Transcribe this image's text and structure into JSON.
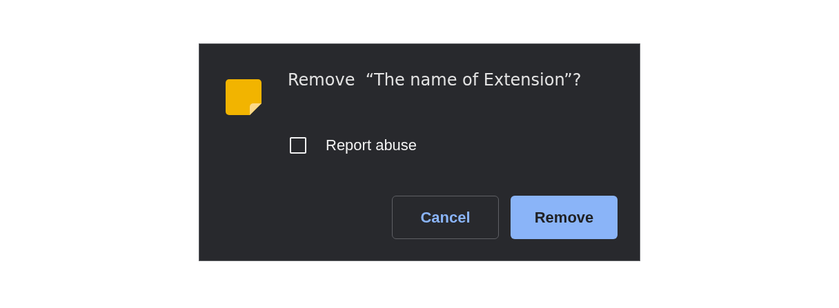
{
  "dialog": {
    "title": "Remove  “The name of Extension”?",
    "checkbox": {
      "label": "Report abuse",
      "checked": false
    },
    "buttons": [
      {
        "label": "Cancel",
        "kind": "secondary"
      },
      {
        "label": "Remove",
        "kind": "primary"
      }
    ]
  }
}
